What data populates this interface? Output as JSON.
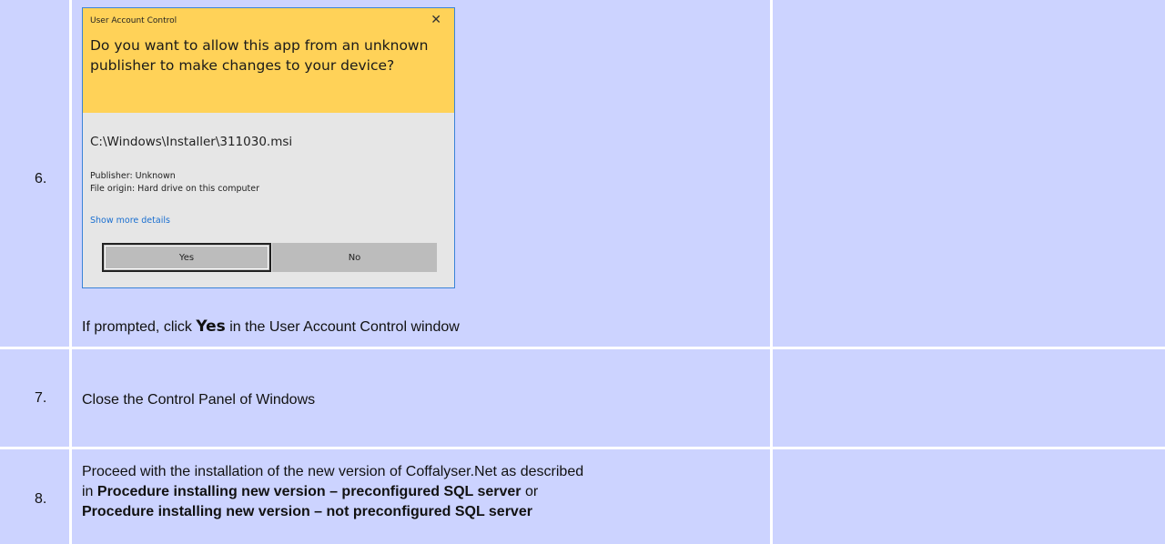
{
  "steps": [
    {
      "number": "6.",
      "instruction_prefix": "If prompted, click ",
      "instruction_bold": "Yes",
      "instruction_suffix": " in the User Account Control window"
    },
    {
      "number": "7.",
      "instruction": "Close the Control Panel of Windows"
    },
    {
      "number": "8.",
      "line1": "Proceed with the installation of the new version of Coffalyser.Net as described",
      "line2_prefix": "in ",
      "line2_bold": "Procedure installing new version – preconfigured SQL server",
      "line2_suffix": " or",
      "line3_bold": "Procedure installing new version – not preconfigured SQL server"
    }
  ],
  "uac": {
    "title": "User Account Control",
    "close_glyph": "✕",
    "question": "Do you want to allow this app from an unknown publisher to make changes to your device?",
    "path": "C:\\Windows\\Installer\\311030.msi",
    "publisher": "Publisher: Unknown",
    "file_origin": "File origin: Hard drive on this computer",
    "more_details": "Show more details",
    "yes": "Yes",
    "no": "No"
  },
  "colors": {
    "row_bg": "#ccd3ff",
    "uac_header": "#ffd258",
    "link": "#1a6fd0"
  }
}
